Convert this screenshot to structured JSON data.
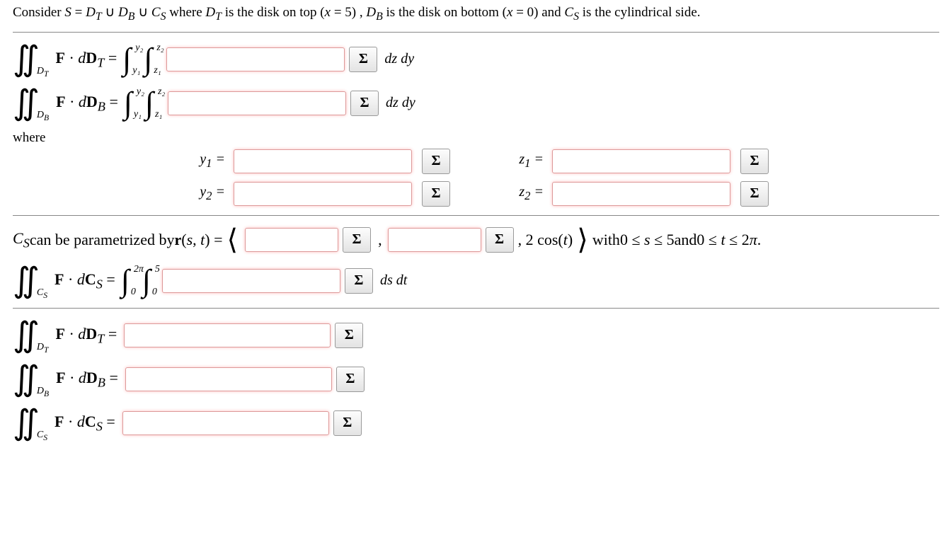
{
  "prompt": {
    "pre": "Consider ",
    "eq": "S = D",
    "t": "T",
    "u1": " ∪ D",
    "b": "B",
    "u2": " ∪ C",
    "s": "S",
    "where1": " where ",
    "dt_is": " is the disk on top ",
    "x5": "(x = 5)",
    "comma": " , ",
    "db_is": " is the disk on bottom ",
    "x0": "(x = 0)",
    "and": " and ",
    "cs_is": " is the cylindrical side."
  },
  "sigma": "Σ",
  "dt": {
    "F": "F",
    "dot": " · ",
    "d": "d",
    "D": "D",
    "sub": "T",
    "eq": " = ",
    "post": "dz dy"
  },
  "db": {
    "sub": "B",
    "post": "dz dy"
  },
  "bounds": {
    "y1": "y₁",
    "y2": "y₂",
    "z1": "z₁",
    "z2": "z₂"
  },
  "whereLabel": "where",
  "yzlabels": {
    "y1": "y₁ =",
    "y2": "y₂ =",
    "z1": "z₁ =",
    "z2": "z₂ ="
  },
  "param": {
    "pre1": "C",
    "pre1sub": "S",
    "pre2": " can be parametrized by ",
    "r": "r",
    "args": "(s, t) = ",
    "langle": "⟨",
    "rangle": "⟩",
    "comma": " , ",
    "third": ", 2 cos(t)",
    "with": " with ",
    "range": "0 ≤ s ≤ 5",
    "and": " and ",
    "range2": "0 ≤ t ≤ 2π."
  },
  "cs": {
    "sub": "S",
    "lo1": "0",
    "hi1": "2π",
    "lo2": "0",
    "hi2": "5",
    "post": "ds dt"
  },
  "final": {
    "dt": "T",
    "db": "B",
    "cs": "S",
    "eq": " = "
  }
}
